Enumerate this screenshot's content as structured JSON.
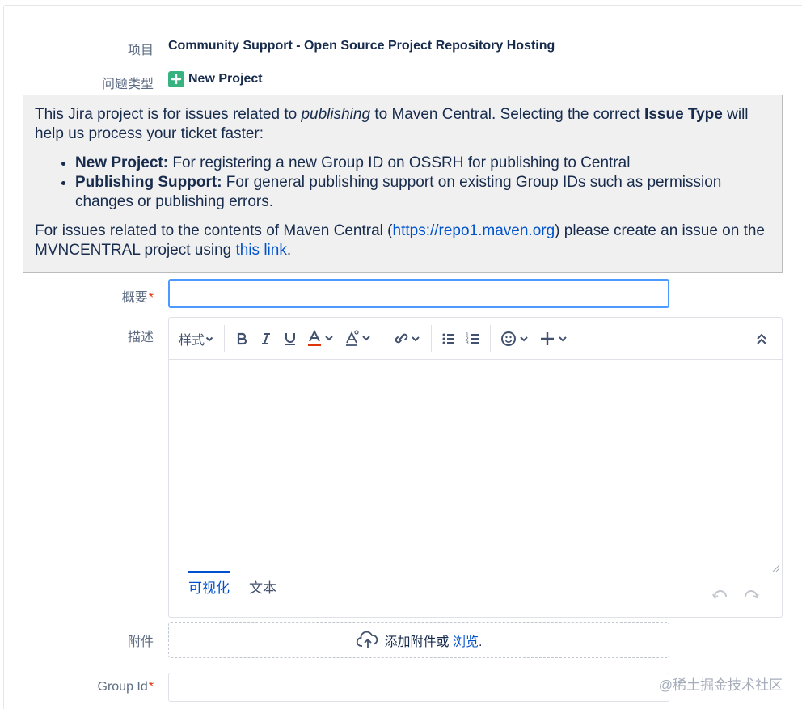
{
  "fields": {
    "project_label": "项目",
    "project_value": "Community Support - Open Source Project Repository Hosting",
    "issue_type_label": "问题类型",
    "issue_type_value": "New Project",
    "summary_label": "概要",
    "description_label": "描述",
    "attachment_label": "附件",
    "group_id_label": "Group Id",
    "required_mark": "*"
  },
  "info": {
    "line1_a": "This Jira project is for issues related to ",
    "line1_em": "publishing",
    "line1_b": " to Maven Central. Selecting the correct ",
    "line1_strong": "Issue Type",
    "line1_c": " will help us process your ticket faster:",
    "bullets": [
      {
        "title": "New Project:",
        "text": " For registering a new Group ID on OSSRH for publishing to Central"
      },
      {
        "title": "Publishing Support:",
        "text": " For general publishing support on existing Group IDs such as permission changes or publishing errors."
      }
    ],
    "line2_a": "For issues related to the contents of Maven Central (",
    "line2_link1": "https://repo1.maven.org",
    "line2_b": ") please create an issue on the MVNCENTRAL project using ",
    "line2_link2": "this link",
    "line2_c": "."
  },
  "editor": {
    "style_label": "样式",
    "tab_visual": "可视化",
    "tab_text": "文本",
    "icons": [
      "bold-icon",
      "italic-icon",
      "underline-icon",
      "text-color-icon",
      "text-effects-icon",
      "link-icon",
      "bullet-list-icon",
      "numbered-list-icon",
      "emoji-icon",
      "insert-icon",
      "collapse-toolbar-icon",
      "undo-icon",
      "redo-icon"
    ]
  },
  "attachment": {
    "text": "添加附件或 ",
    "browse": "浏览",
    "dot": "."
  },
  "watermark": "@稀土掘金技术社区",
  "colors": {
    "accent": "#0052cc",
    "focus": "#4c9aff",
    "plus_green": "#36b37e",
    "info_bg": "#f0f0f0",
    "required": "#de350b"
  }
}
